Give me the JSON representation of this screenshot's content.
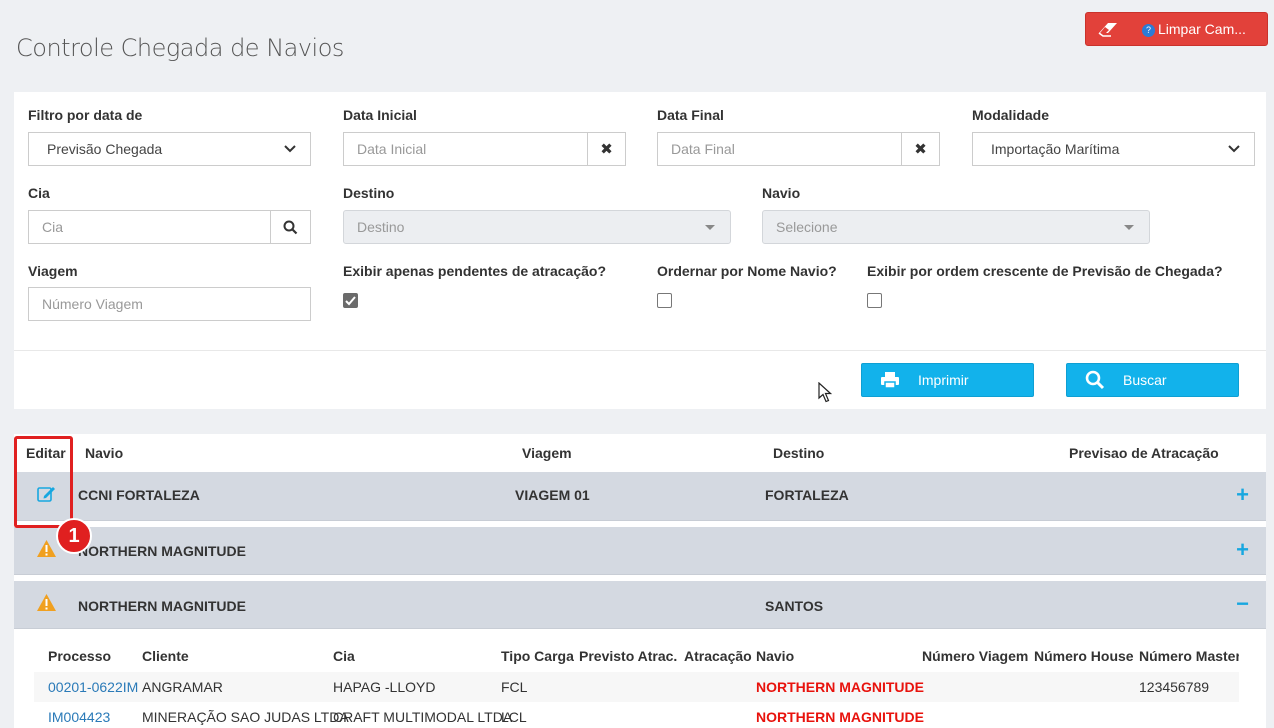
{
  "page": {
    "title": "Controle Chegada de Navios"
  },
  "header": {
    "clear_button_label": "Limpar Cam..."
  },
  "filters": {
    "date_filter": {
      "label": "Filtro por data de",
      "value": "Previsão Chegada"
    },
    "start_date": {
      "label": "Data Inicial",
      "placeholder": "Data Inicial"
    },
    "end_date": {
      "label": "Data Final",
      "placeholder": "Data Final"
    },
    "modality": {
      "label": "Modalidade",
      "value": "Importação Marítima"
    },
    "cia": {
      "label": "Cia",
      "placeholder": "Cia"
    },
    "destination": {
      "label": "Destino",
      "placeholder": "Destino"
    },
    "ship": {
      "label": "Navio",
      "placeholder": "Selecione"
    },
    "voyage": {
      "label": "Viagem",
      "placeholder": "Número Viagem"
    },
    "pending_only": {
      "label": "Exibir apenas pendentes de atracação?",
      "checked": true
    },
    "order_by_name": {
      "label": "Ordernar por Nome Navio?",
      "checked": false
    },
    "order_asc": {
      "label": "Exibir por ordem crescente de Previsão de Chegada?",
      "checked": false
    },
    "print_label": "Imprimir",
    "search_label": "Buscar"
  },
  "results": {
    "headers": {
      "edit": "Editar",
      "ship": "Navio",
      "voyage": "Viagem",
      "destination": "Destino",
      "berthing": "Previsao de Atracação"
    },
    "rows": [
      {
        "ship": "CCNI FORTALEZA",
        "voyage": "VIAGEM 01",
        "destination": "FORTALEZA",
        "toggle": "+"
      },
      {
        "ship": "NORTHERN MAGNITUDE",
        "voyage": "",
        "destination": "",
        "toggle": "+"
      },
      {
        "ship": "NORTHERN MAGNITUDE",
        "voyage": "",
        "destination": "SANTOS",
        "toggle": "−"
      }
    ],
    "annotation_number": "1",
    "detail": {
      "headers": [
        "Processo",
        "Cliente",
        "Cia",
        "Tipo Carga",
        "Previsto Atrac.",
        "Atracação",
        "Navio",
        "Número Viagem",
        "Número House",
        "Número Master"
      ],
      "rows": [
        [
          "00201-0622IM",
          "ANGRAMAR",
          "HAPAG -LLOYD",
          "FCL",
          "",
          "",
          "NORTHERN MAGNITUDE",
          "",
          "",
          "123456789"
        ],
        [
          "IM004423",
          "MINERAÇÃO SAO JUDAS LTDA",
          "CRAFT MULTIMODAL LTDA",
          "LCL",
          "",
          "",
          "NORTHERN MAGNITUDE",
          "",
          "",
          ""
        ]
      ]
    }
  },
  "colors": {
    "primary": "#12b2eb",
    "danger": "#e2413a",
    "row_bg": "#d4d9e1",
    "warning": "#f0a020"
  }
}
